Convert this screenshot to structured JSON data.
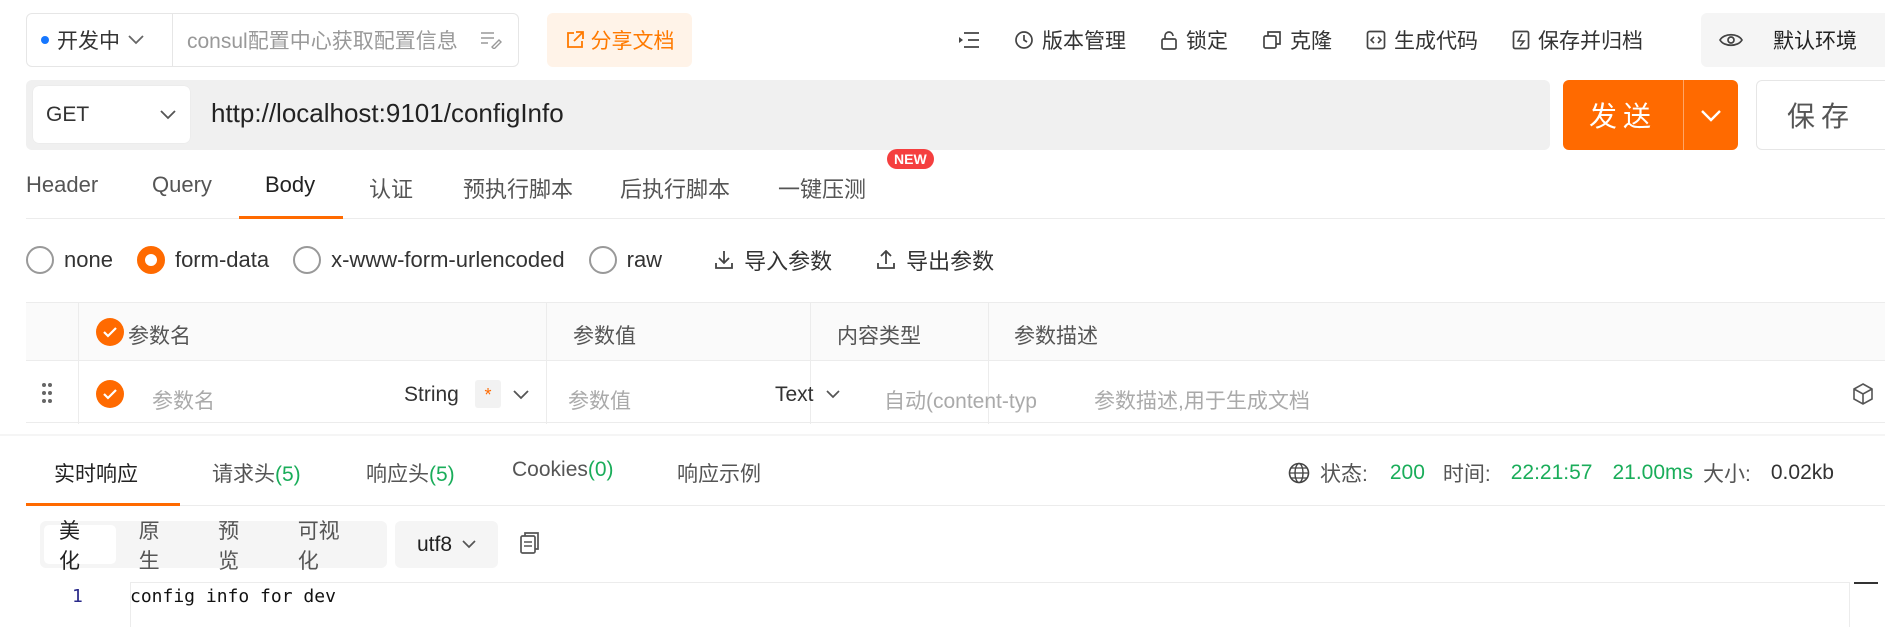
{
  "top_bar": {
    "env_name": "开发中",
    "env_color": "#1677ff",
    "doc_title": "consul配置中心获取配置信息",
    "share_label": "分享文档",
    "toolbar": {
      "version": "版本管理",
      "lock": "锁定",
      "clone": "克隆",
      "gen_code": "生成代码",
      "save_archive": "保存并归档"
    },
    "environment": "默认环境"
  },
  "request": {
    "method": "GET",
    "url": "http://localhost:9101/configInfo",
    "send_label": "发送",
    "save_label": "保存",
    "accent": "#ff6a00"
  },
  "tabs": {
    "header": "Header",
    "query": "Query",
    "body": "Body",
    "auth": "认证",
    "pre_script": "预执行脚本",
    "post_script": "后执行脚本",
    "stress": "一键压测",
    "new_badge": "NEW",
    "active": "Body"
  },
  "body_types": {
    "none": "none",
    "form_data": "form-data",
    "urlencoded": "x-www-form-urlencoded",
    "raw": "raw",
    "selected": "form-data",
    "import_label": "导入参数",
    "export_label": "导出参数"
  },
  "params_table": {
    "columns": {
      "name": "参数名",
      "value": "参数值",
      "content_type": "内容类型",
      "desc": "参数描述"
    },
    "row": {
      "name_placeholder": "参数名",
      "type": "String",
      "required_mark": "*",
      "value_placeholder": "参数值",
      "value_type": "Text",
      "content_type_placeholder": "自动(content-typ",
      "desc_placeholder": "参数描述,用于生成文档"
    }
  },
  "response": {
    "tabs": {
      "realtime": "实时响应",
      "req_headers": "请求头",
      "req_headers_count": "(5)",
      "resp_headers": "响应头",
      "resp_headers_count": "(5)",
      "cookies": "Cookies",
      "cookies_count": "(0)",
      "example": "响应示例"
    },
    "status_label": "状态:",
    "status_value": "200",
    "time_label": "时间:",
    "time_value": "22:21:57",
    "duration": "21.00ms",
    "size_label": "大小:",
    "size_value": "0.02kb",
    "formats": {
      "pretty": "美化",
      "raw": "原生",
      "preview": "预览",
      "visual": "可视化"
    },
    "encoding": "utf8",
    "code_lines": [
      {
        "num": "1",
        "text": "config info for dev"
      }
    ]
  }
}
